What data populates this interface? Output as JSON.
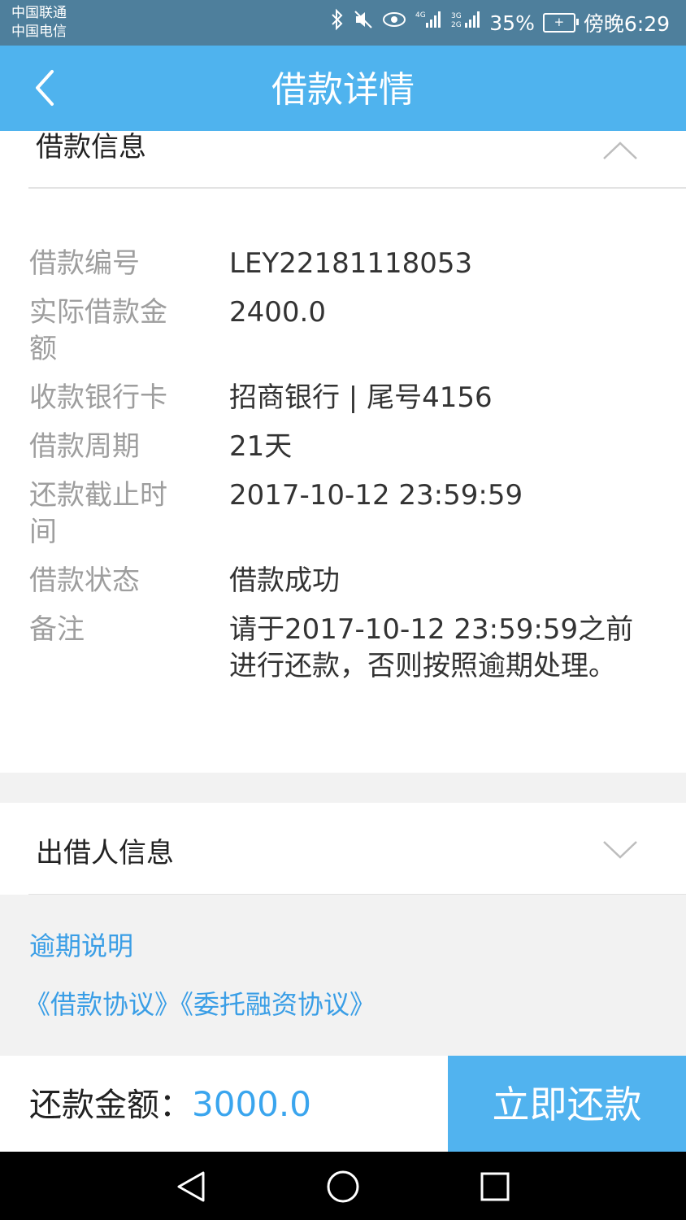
{
  "status_bar": {
    "carrier_1": "中国联通",
    "carrier_2": "中国电信",
    "battery": "35%",
    "time": "傍晚6:29",
    "icons": [
      "bluetooth-icon",
      "mute-icon",
      "eye-icon",
      "signal-4g-icon",
      "signal-3g-icon",
      "battery-icon"
    ]
  },
  "nav": {
    "title": "借款详情"
  },
  "loan_section": {
    "title": "借款信息",
    "rows": [
      {
        "label": "借款编号",
        "value": "LEY22181118053"
      },
      {
        "label": "实际借款金额",
        "value": "2400.0"
      },
      {
        "label": "收款银行卡",
        "value": "招商银行 | 尾号4156"
      },
      {
        "label": "借款周期",
        "value": "21天"
      },
      {
        "label": "还款截止时间",
        "value": "2017-10-12 23:59:59"
      },
      {
        "label": "借款状态",
        "value": "借款成功"
      },
      {
        "label": "备注",
        "value": "请于2017-10-12 23:59:59之前进行还款，否则按照逾期处理。"
      }
    ]
  },
  "lender_section": {
    "title": "出借人信息"
  },
  "links": {
    "overdue": "逾期说明",
    "loan_agreement": "《借款协议》",
    "entrust_agreement": "《委托融资协议》"
  },
  "bottom": {
    "repay_label": "还款金额：",
    "repay_amount": "3000.0",
    "repay_button": "立即还款"
  },
  "colors": {
    "nav_bg": "#4fb3ee",
    "status_bg": "#4e7f9c",
    "link": "#3a9ee6",
    "button_bg": "#51b3ef"
  }
}
